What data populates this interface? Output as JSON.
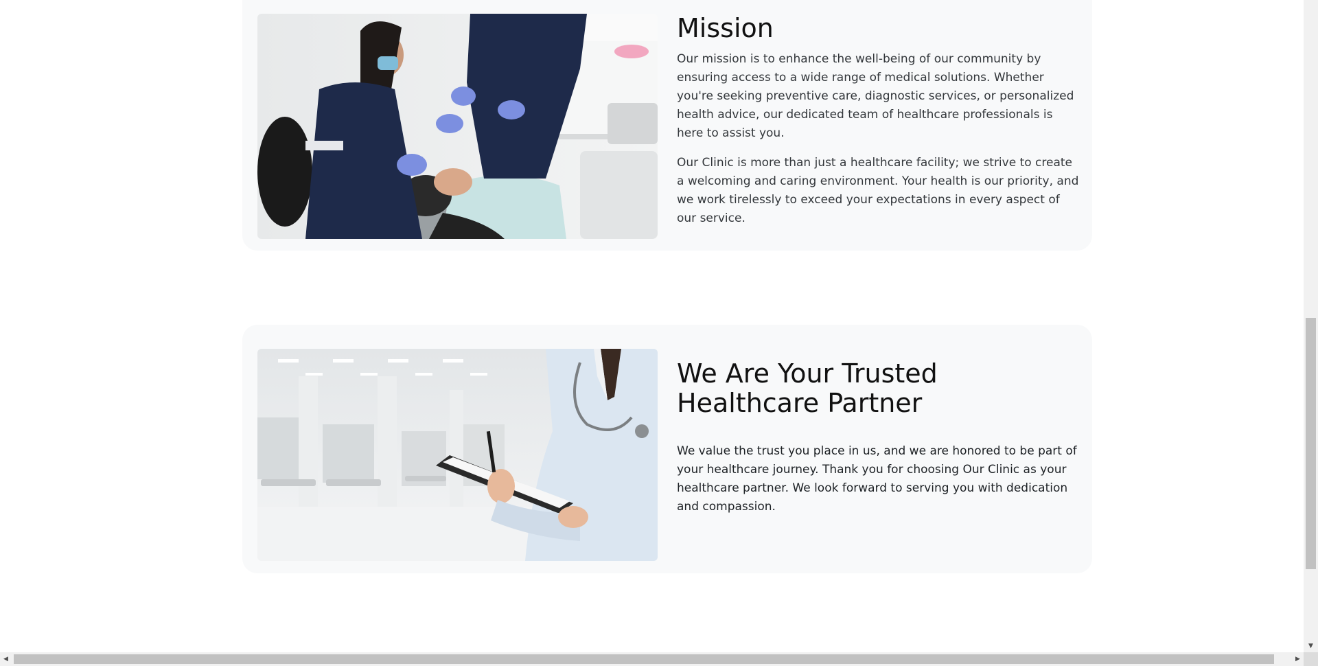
{
  "mission": {
    "title": "Mission",
    "paragraphs": [
      "Our mission is to enhance the well-being of our community by ensuring access to a wide range of medical solutions. Whether you're seeking preventive care, diagnostic services, or personalized health advice, our dedicated team of healthcare professionals is here to assist you.",
      "Our Clinic is more than just a healthcare facility; we strive to create a welcoming and caring environment. Your health is our priority, and we work tirelessly to exceed your expectations in every aspect of our service."
    ],
    "image_icon": "dentist-treating-patient-photo"
  },
  "partner": {
    "title": "We Are Your Trusted Healthcare Partner",
    "paragraphs": [
      "We value the trust you place in us, and we are honored to be part of your healthcare journey. Thank you for choosing Our Clinic as your healthcare partner. We look forward to serving you with dedication and compassion."
    ],
    "image_icon": "doctor-with-clipboard-photo"
  },
  "colors": {
    "card_bg": "#f8f9fa",
    "page_bg": "#ffffff",
    "scrub_navy": "#1e2a4a",
    "glove_blue": "#7c8fe0"
  },
  "scrollbars": {
    "up_arrow": "▲",
    "down_arrow": "▼",
    "left_arrow": "◀",
    "right_arrow": "▶"
  }
}
